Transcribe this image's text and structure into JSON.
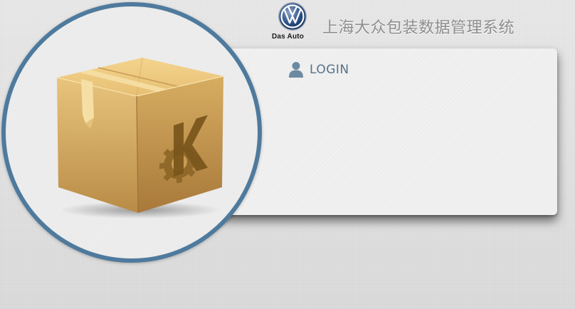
{
  "header": {
    "brand_tagline": "Das Auto",
    "system_title": "上海大众包装数据管理系统"
  },
  "login": {
    "heading": "LOGIN"
  },
  "colors": {
    "circle_border": "#4e7a9d",
    "login_text": "#55728a",
    "title_text": "#8e8e8e"
  },
  "icons": {
    "brand": "vw-logo-icon",
    "user": "user-icon",
    "product": "package-box-icon"
  }
}
